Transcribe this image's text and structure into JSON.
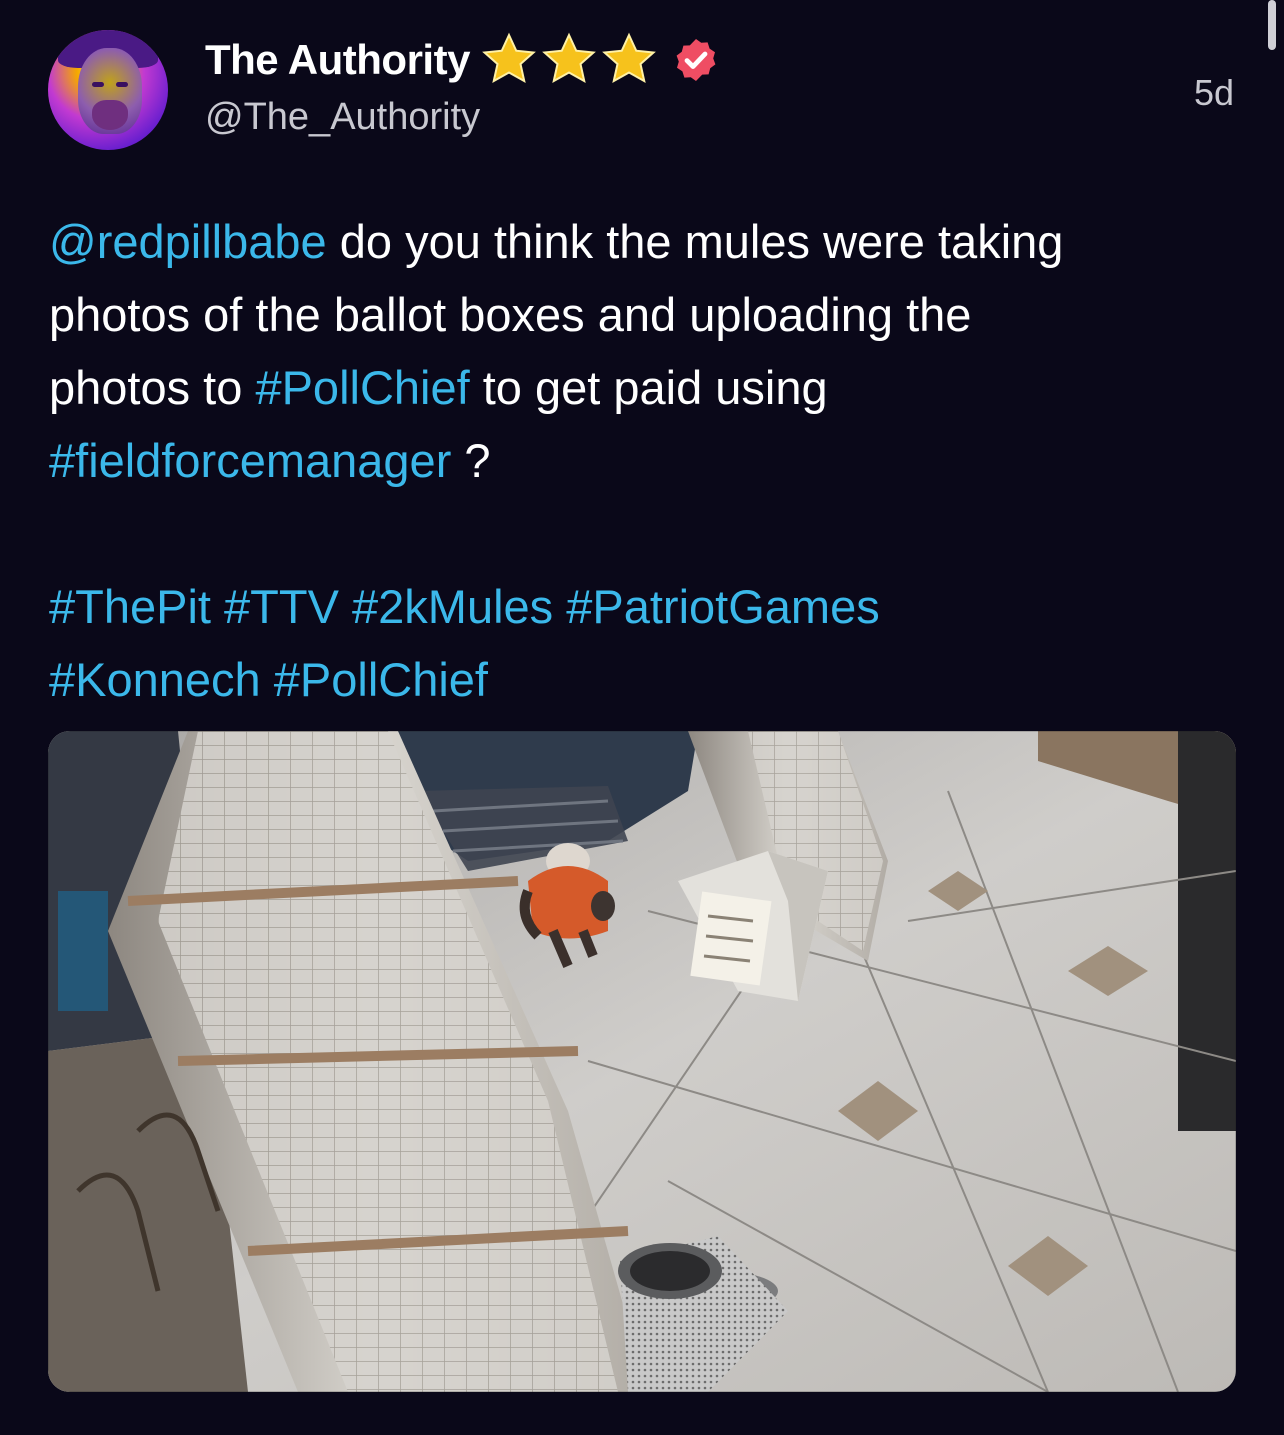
{
  "author": {
    "name": "The Authority",
    "handle": "@The_Authority",
    "star_count": 3,
    "verified": true,
    "star_color": "#f6c21c",
    "verified_color": "#ef4d63"
  },
  "post": {
    "time": "5d",
    "mention": "@redpillbabe",
    "line1_text": " do you think the mules were taking",
    "line2_text": "photos of the ballot boxes and uploading the",
    "line3_prefix": "photos to ",
    "line3_tag": "#PollChief",
    "line3_suffix": " to get paid using",
    "line4_tag": "#fieldforcemanager",
    "line4_suffix": " ?",
    "tags_row1": [
      "#ThePit",
      "#TTV",
      "#2kMules",
      "#PatriotGames"
    ],
    "tags_row2": [
      "#Konnech",
      "#PollChief"
    ]
  },
  "colors": {
    "background": "#0a0819",
    "link": "#3bb8ea",
    "text": "#ffffff",
    "secondary": "#c8c8d0"
  },
  "icons": {
    "stars": "star-icon",
    "verified": "verified-badge-icon"
  }
}
